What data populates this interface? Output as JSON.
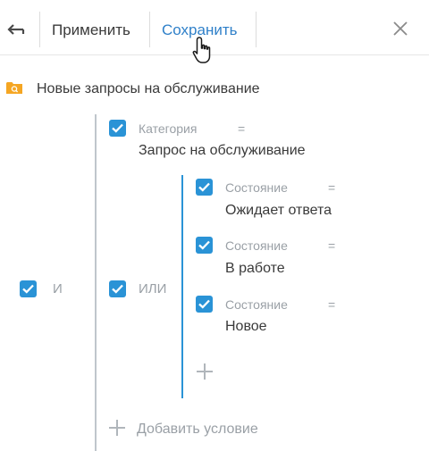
{
  "toolbar": {
    "back_icon": "back-arrow-icon",
    "apply_label": "Применить",
    "save_label": "Сохранить",
    "close_icon": "close-icon",
    "save_color": "#2f80c9"
  },
  "filter": {
    "title": "Новые запросы на обслуживание",
    "folder_icon": "search-folder-icon",
    "root_group": {
      "operator": "И",
      "checked": true
    },
    "condition_category": {
      "column": "Категория",
      "comparison": "=",
      "value": "Запрос на обслуживание",
      "checked": true
    },
    "or_group": {
      "operator": "ИЛИ",
      "checked": true,
      "conditions": [
        {
          "column": "Состояние",
          "comparison": "=",
          "value": "Ожидает ответа",
          "checked": true
        },
        {
          "column": "Состояние",
          "comparison": "=",
          "value": "В работе",
          "checked": true
        },
        {
          "column": "Состояние",
          "comparison": "=",
          "value": "Новое",
          "checked": true
        }
      ]
    },
    "add_condition_label": "Добавить условие"
  },
  "colors": {
    "accent": "#2a93d6",
    "folder": "#f5a623",
    "muted": "#9aa0a6"
  }
}
